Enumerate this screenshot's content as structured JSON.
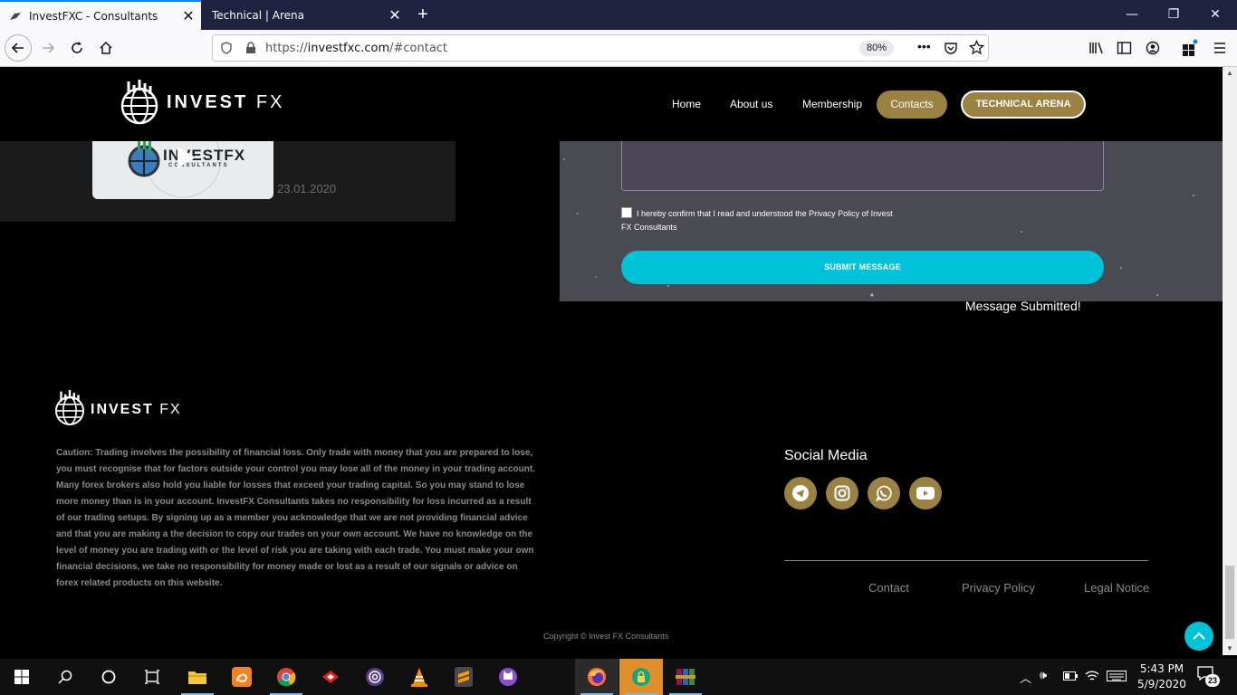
{
  "browser": {
    "tabs": [
      {
        "title": "InvestFXC - Consultants",
        "active": true
      },
      {
        "title": "Technical | Arena",
        "active": false
      }
    ],
    "url_prefix": "https://",
    "url_host": "investfxc.com",
    "url_path": "/#contact",
    "zoom": "80%"
  },
  "header": {
    "brand": "INVEST",
    "brand_suffix": "FX",
    "menu": [
      "Home",
      "About us",
      "Membership",
      "Contacts"
    ],
    "cta": "TECHNICAL ARENA"
  },
  "video": {
    "thumb_text": "INVESTFX",
    "thumb_sub": "CONSULTANTS",
    "date": "23.01.2020"
  },
  "form": {
    "consent": "I hereby confirm that I read and understood the Privacy Policy of Invest FX Consultants",
    "submit_label": "SUBMIT MESSAGE",
    "submitted_text": "Message Submitted!"
  },
  "footer": {
    "brand": "INVEST",
    "brand_suffix": "FX",
    "disclaimer": "Caution: Trading involves the possibility of financial loss. Only trade with money that you are prepared to lose, you must recognise that for factors outside your control you may lose all of the money in your trading account. Many forex brokers also hold you liable for losses that exceed your trading capital. So you may stand to lose more money than is in your account. InvestFX Consultants takes no responsibility for loss incurred as a result of our trading setups. By signing up as a member you acknowledge that we are not providing financial advice and that you are making a the decision to copy our trades on your own account. We have no knowledge on the level of money you are trading with or the level of risk you are taking with each trade. You must make your own financial decisions, we take no responsibility for money made or lost as a result of our signals or advice on forex related products on this website.",
    "social_title": "Social Media",
    "social_icons": [
      "telegram-icon",
      "instagram-icon",
      "whatsapp-icon",
      "youtube-icon"
    ],
    "links": [
      "Contact",
      "Privacy Policy",
      "Legal Notice"
    ],
    "copyright": "Copyright © Invest FX Consultants"
  },
  "taskbar": {
    "time": "5:43 PM",
    "date": "5/9/2020",
    "notifications": "23"
  },
  "colors": {
    "gold": "#9b8142",
    "cyan": "#00c2d8",
    "tabbar": "#202340"
  }
}
